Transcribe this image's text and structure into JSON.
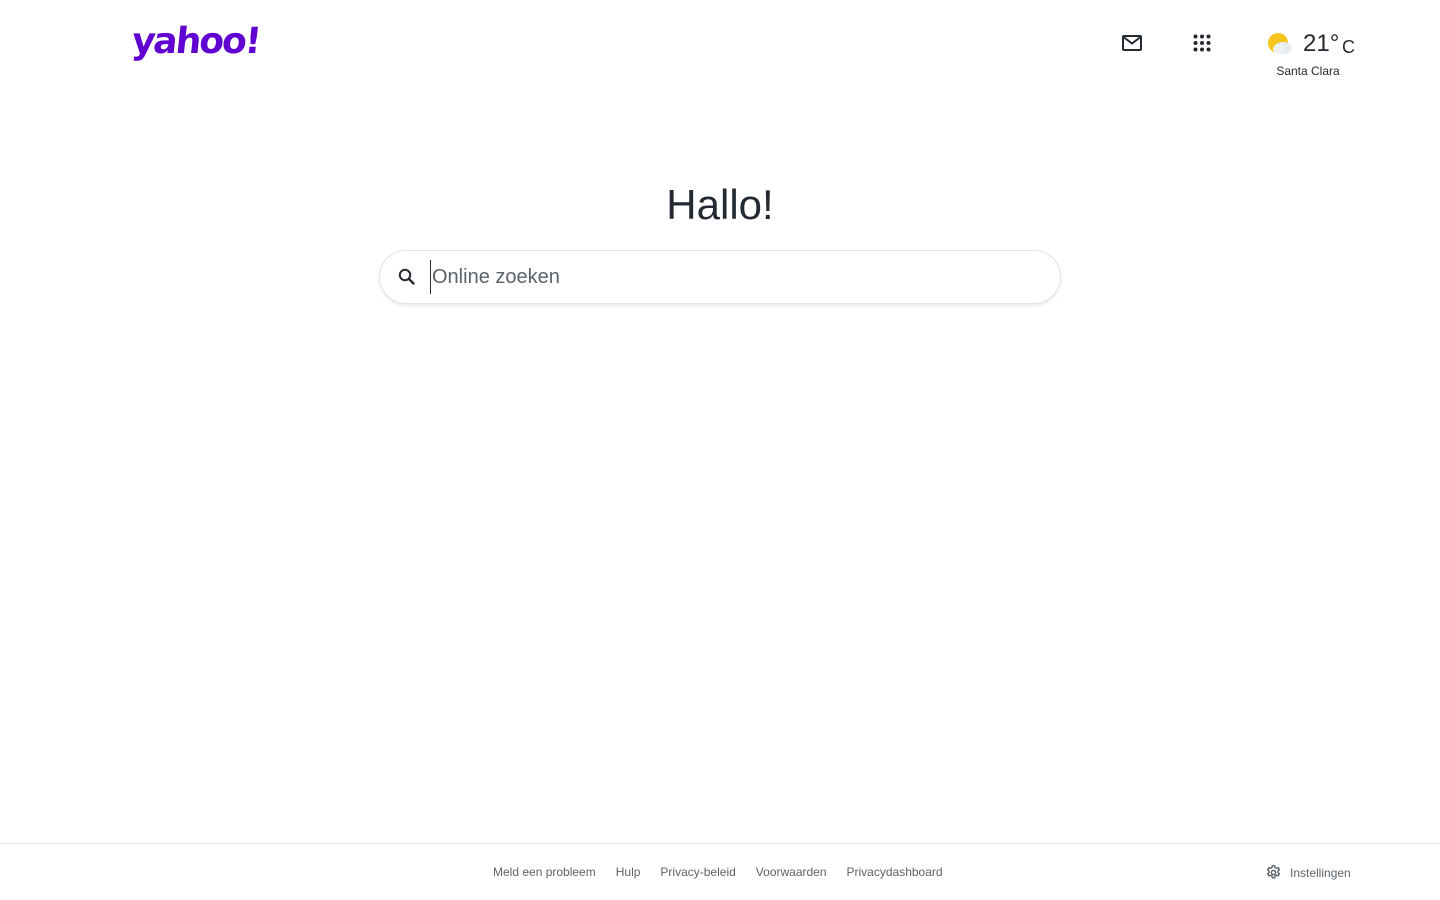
{
  "header": {
    "logo_text": "yahoo!",
    "mail_icon": "mail-icon",
    "apps_icon": "apps-grid-icon",
    "weather": {
      "icon": "partly-cloudy-icon",
      "temperature": "21°",
      "unit": "C",
      "city": "Santa Clara"
    }
  },
  "main": {
    "greeting": "Hallo!",
    "search": {
      "placeholder": "Online zoeken",
      "value": "",
      "icon": "search-icon"
    }
  },
  "footer": {
    "links": [
      "Meld een probleem",
      "Hulp",
      "Privacy-beleid",
      "Voorwaarden",
      "Privacydashboard"
    ],
    "settings_label": "Instellingen",
    "settings_icon": "gear-icon"
  },
  "colors": {
    "brand": "#6001d2",
    "text": "#232a31",
    "muted": "#5b636a",
    "border": "#e0e4e9"
  }
}
